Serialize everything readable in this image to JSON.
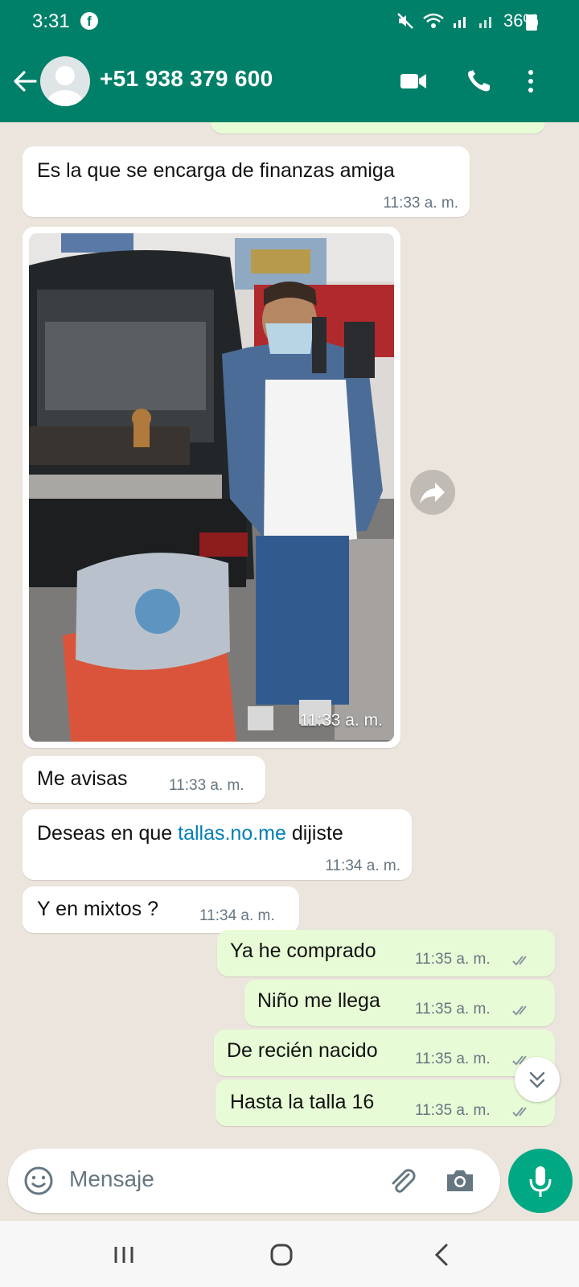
{
  "status_bar": {
    "time": "3:31",
    "battery": "36%"
  },
  "header": {
    "contact": "+51 938 379 600",
    "icons": [
      "back-arrow-icon",
      "avatar",
      "video-call-icon",
      "phone-icon",
      "more-options-icon"
    ]
  },
  "messages": [
    {
      "direction": "in",
      "text": "Es la que se encarga de finanzas amiga",
      "time": "11:33 a. m."
    },
    {
      "direction": "in",
      "type": "image",
      "time": "11:33 a. m."
    },
    {
      "direction": "in",
      "text": "Me avisas",
      "time": "11:33 a. m."
    },
    {
      "direction": "in",
      "text_pre": "Deseas en que ",
      "text_link": "tallas.no.me",
      "text_post": " dijiste",
      "time": "11:34 a. m."
    },
    {
      "direction": "in",
      "text": "Y en mixtos ?",
      "time": "11:34 a. m."
    },
    {
      "direction": "out",
      "text": "Ya he comprado",
      "time": "11:35 a. m."
    },
    {
      "direction": "out",
      "text": "Niño me llega",
      "time": "11:35 a. m."
    },
    {
      "direction": "out",
      "text": "De recién nacido",
      "time": "11:35 a. m."
    },
    {
      "direction": "out",
      "text": "Hasta la talla 16",
      "time": "11:35 a. m."
    }
  ],
  "composer": {
    "placeholder": "Mensaje"
  },
  "colors": {
    "header": "#008069",
    "outgoing_bubble": "#e7fcd6",
    "incoming_bubble": "#ffffff",
    "chat_bg": "#ece5dd",
    "mic_button": "#00a884",
    "link": "#027eb5"
  }
}
